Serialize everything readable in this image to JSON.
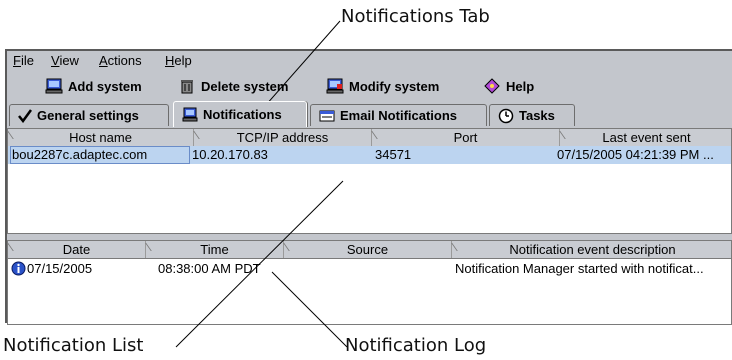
{
  "callouts": {
    "tab": "Notifications Tab",
    "list": "Notification List",
    "log": "Notification Log"
  },
  "menu": [
    "File",
    "View",
    "Actions",
    "Help"
  ],
  "toolbar": {
    "add": "Add system",
    "delete": "Delete system",
    "modify": "Modify system",
    "help": "Help"
  },
  "tabs": {
    "general": "General settings",
    "notifications": "Notifications",
    "email": "Email Notifications",
    "tasks": "Tasks"
  },
  "notification_list": {
    "columns": [
      "Host name",
      "TCP/IP address",
      "Port",
      "Last event sent"
    ],
    "rows": [
      [
        "bou2287c.adaptec.com",
        "10.20.170.83",
        "34571",
        "07/15/2005 04:21:39 PM ..."
      ]
    ]
  },
  "notification_log": {
    "columns": [
      "Date",
      "Time",
      "Source",
      "Notification event description"
    ],
    "rows": [
      [
        "07/15/2005",
        "08:38:00 AM PDT",
        "",
        "Notification Manager started with notificat..."
      ]
    ]
  },
  "icons": {
    "add": "add-system-icon",
    "delete": "delete-system-icon",
    "modify": "modify-system-icon",
    "help": "help-icon",
    "info": "info-icon"
  }
}
